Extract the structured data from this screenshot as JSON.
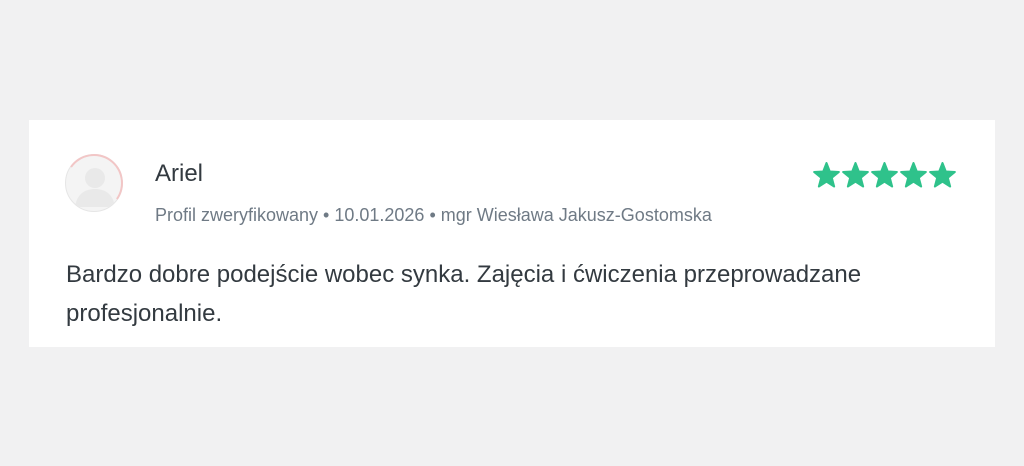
{
  "review": {
    "author": "Ariel",
    "rating": 5,
    "rating_max": 5,
    "star_color": "#2fc28b",
    "status": "Profil zweryfikowany",
    "separator": "•",
    "date": "10.01.2026",
    "doctor": "mgr Wiesława Jakusz-Gostomska",
    "text": "Bardzo dobre podejście wobec synka. Zajęcia i ćwiczenia przeprowadzane profesjonalnie.",
    "avatar_icon": "user-placeholder-icon",
    "star_icon": "star-icon"
  }
}
